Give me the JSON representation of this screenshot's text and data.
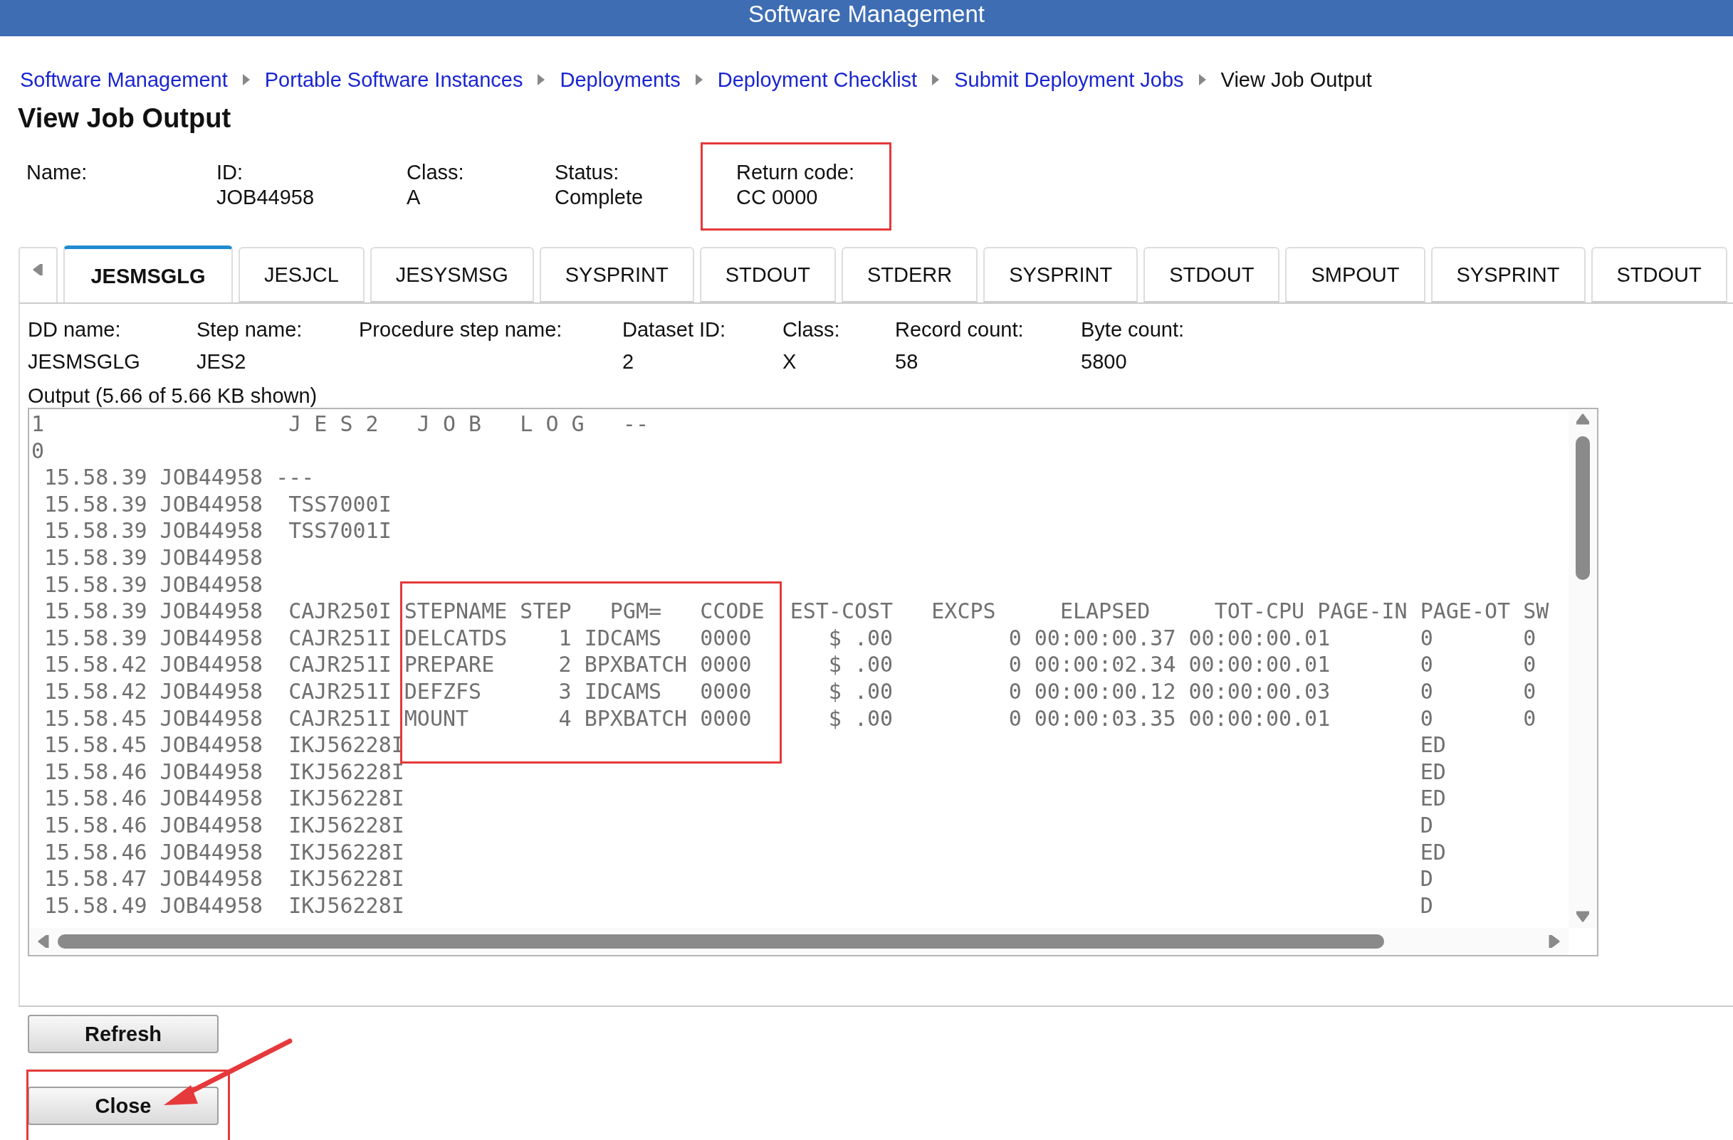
{
  "header": {
    "title": "Software Management"
  },
  "breadcrumb": [
    {
      "label": "Software Management",
      "current": false
    },
    {
      "label": "Portable Software Instances",
      "current": false
    },
    {
      "label": "Deployments",
      "current": false
    },
    {
      "label": "Deployment Checklist",
      "current": false
    },
    {
      "label": "Submit Deployment Jobs",
      "current": false
    },
    {
      "label": "View Job Output",
      "current": true
    }
  ],
  "page_title": "View Job Output",
  "job_fields": [
    {
      "label": "Name:",
      "highlighted": false
    },
    {
      "label": "ID:",
      "value": "JOB44958",
      "highlighted": false
    },
    {
      "label": "Class:",
      "value": "A",
      "highlighted": false
    },
    {
      "label": "Status:",
      "value": "Complete",
      "highlighted": false
    },
    {
      "label": "Return code:",
      "value": "CC 0000",
      "highlighted": true
    }
  ],
  "tabs": [
    {
      "label": "JESMSGLG",
      "selected": true
    },
    {
      "label": "JESJCL",
      "selected": false
    },
    {
      "label": "JESYSMSG",
      "selected": false
    },
    {
      "label": "SYSPRINT",
      "selected": false
    },
    {
      "label": "STDOUT",
      "selected": false
    },
    {
      "label": "STDERR",
      "selected": false
    },
    {
      "label": "SYSPRINT",
      "selected": false
    },
    {
      "label": "STDOUT",
      "selected": false
    },
    {
      "label": "SMPOUT",
      "selected": false
    },
    {
      "label": "SYSPRINT",
      "selected": false
    },
    {
      "label": "STDOUT",
      "selected": false
    }
  ],
  "dd_fields": [
    {
      "label": "DD name:",
      "value": "JESMSGLG"
    },
    {
      "label": "Step name:",
      "value": "JES2"
    },
    {
      "label": "Procedure step name:"
    },
    {
      "label": "Dataset ID:",
      "value": "2"
    },
    {
      "label": "Class:",
      "value": "X"
    },
    {
      "label": "Record count:",
      "value": "58"
    },
    {
      "label": "Byte count:",
      "value": "5800"
    }
  ],
  "output": {
    "caption": "Output (5.66 of 5.66 KB shown)",
    "lines": [
      "1                   J E S 2   J O B   L O G   --",
      "0",
      " 15.58.39 JOB44958 ---",
      " 15.58.39 JOB44958  TSS7000I",
      " 15.58.39 JOB44958  TSS7001I",
      " 15.58.39 JOB44958",
      " 15.58.39 JOB44958",
      " 15.58.39 JOB44958  CAJR250I STEPNAME STEP   PGM=   CCODE  EST-COST   EXCPS     ELAPSED     TOT-CPU PAGE-IN PAGE-OT SW",
      " 15.58.39 JOB44958  CAJR251I DELCATDS    1 IDCAMS   0000      $ .00         0 00:00:00.37 00:00:00.01       0       0",
      " 15.58.42 JOB44958  CAJR251I PREPARE     2 BPXBATCH 0000      $ .00         0 00:00:02.34 00:00:00.01       0       0",
      " 15.58.42 JOB44958  CAJR251I DEFZFS      3 IDCAMS   0000      $ .00         0 00:00:00.12 00:00:00.03       0       0",
      " 15.58.45 JOB44958  CAJR251I MOUNT       4 BPXBATCH 0000      $ .00         0 00:00:03.35 00:00:00.01       0       0",
      " 15.58.45 JOB44958  IKJ56228I                                                                               ED",
      " 15.58.46 JOB44958  IKJ56228I                                                                               ED",
      " 15.58.46 JOB44958  IKJ56228I                                                                               ED",
      " 15.58.46 JOB44958  IKJ56228I                                                                               D",
      " 15.58.46 JOB44958  IKJ56228I                                                                               ED",
      " 15.58.47 JOB44958  IKJ56228I                                                                               D",
      " 15.58.49 JOB44958  IKJ56228I                                                                               D"
    ]
  },
  "buttons": [
    {
      "label": "Refresh",
      "highlighted": false
    },
    {
      "label": "Close",
      "highlighted": true
    }
  ]
}
